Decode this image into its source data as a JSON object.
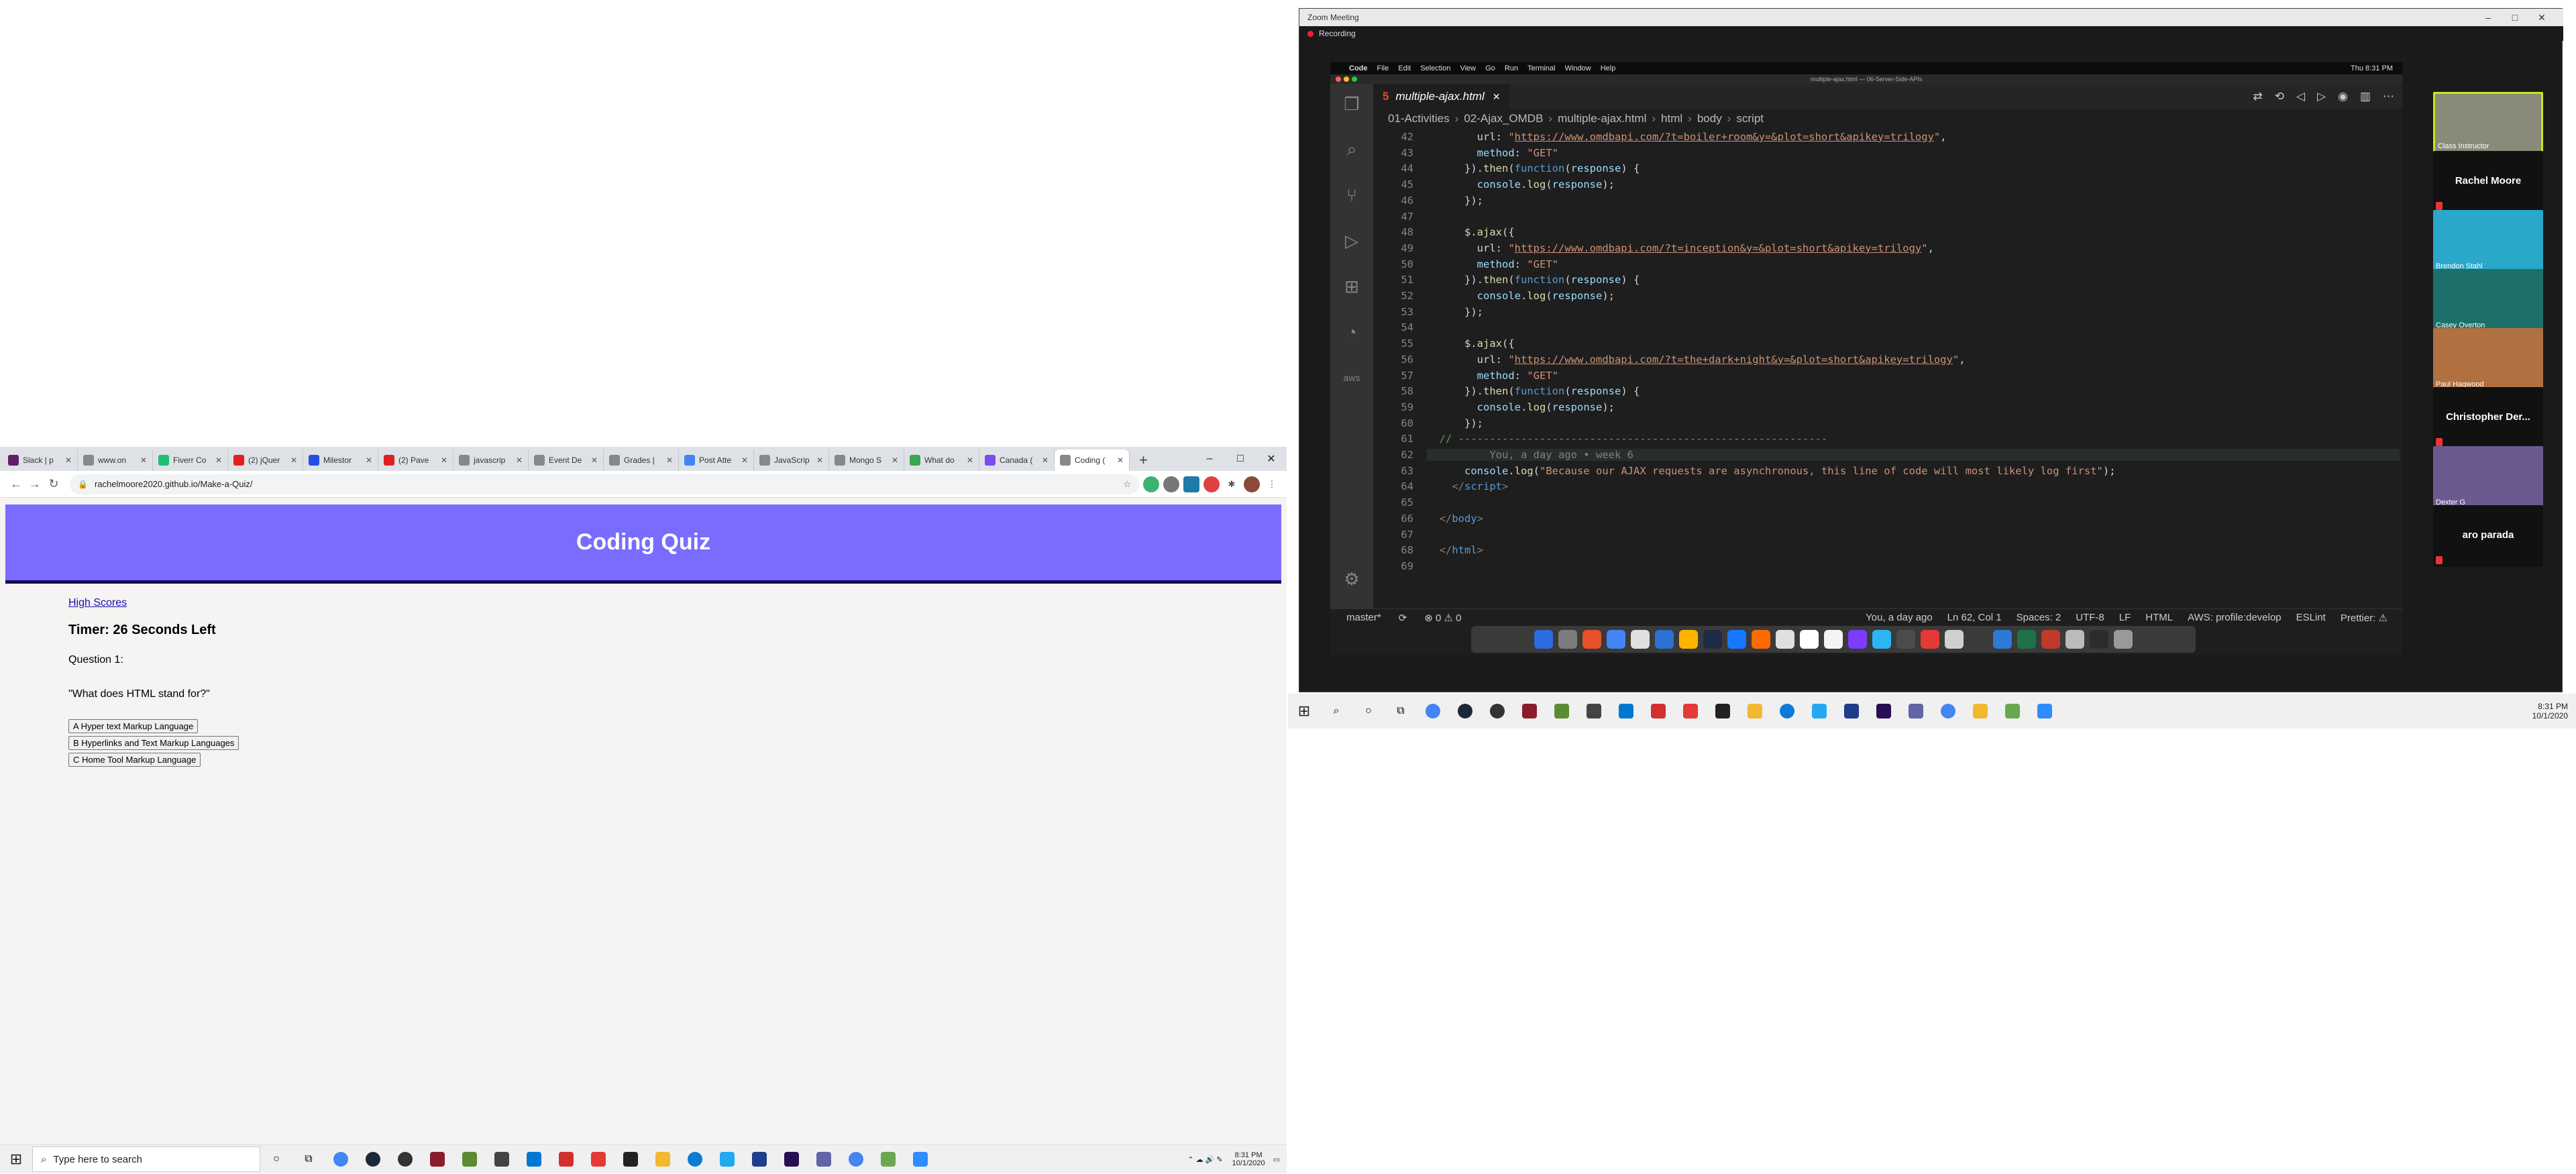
{
  "chrome": {
    "tabs": [
      {
        "label": "Slack | p",
        "color": "#611f69"
      },
      {
        "label": "www.on",
        "color": "#888888"
      },
      {
        "label": "Fiverr Co",
        "color": "#1dbf73"
      },
      {
        "label": "(2) jQuer",
        "color": "#e02020"
      },
      {
        "label": "Milestor",
        "color": "#264de4"
      },
      {
        "label": "(2) Pave",
        "color": "#e02020"
      },
      {
        "label": "javascrip",
        "color": "#888888"
      },
      {
        "label": "Event De",
        "color": "#888888"
      },
      {
        "label": "Grades |",
        "color": "#888888"
      },
      {
        "label": "Post Atte",
        "color": "#4285f4"
      },
      {
        "label": "JavaScrip",
        "color": "#888888"
      },
      {
        "label": "Mongo S",
        "color": "#888888"
      },
      {
        "label": "What do",
        "color": "#34a853"
      },
      {
        "label": "Canada (",
        "color": "#7a4cf0"
      },
      {
        "label": "Coding (",
        "color": "#888888"
      }
    ],
    "active_tab": 14,
    "url": "rachelmoore2020.github.io/Make-a-Quiz/",
    "win": {
      "min": "–",
      "max": "□",
      "close": "✕"
    },
    "newtab": "+"
  },
  "quiz": {
    "title": "Coding Quiz",
    "highscores": "High Scores",
    "timer": "Timer: 26 Seconds Left",
    "question_number": "Question 1:",
    "question_text": "\"What does HTML stand for?\"",
    "answers": [
      "A Hyper text Markup Language",
      "B Hyperlinks and Text Markup Languages",
      "C Home Tool Markup Language"
    ]
  },
  "left_taskbar": {
    "search_placeholder": "Type here to search",
    "time": "8:31 PM",
    "date": "10/1/2020"
  },
  "zoom": {
    "title": "Zoom Meeting",
    "recording": "Recording",
    "mac_menu": [
      "Code",
      "File",
      "Edit",
      "Selection",
      "View",
      "Go",
      "Run",
      "Terminal",
      "Window",
      "Help"
    ],
    "mac_clock": "Thu 8:31 PM",
    "vscode_title": "multiple-ajax.html — 06-Server-Side-APIs",
    "file_tab": "multiple-ajax.html",
    "breadcrumb": [
      "01-Activities",
      "02-Ajax_OMDB",
      "multiple-ajax.html",
      "html",
      "body",
      "script"
    ],
    "code_lines": [
      {
        "n": "42",
        "html": "        url: <span class='s'>\"</span><span class='u'>https://www.omdbapi.com/?t=boiler+room&y=&plot=short&apikey=trilogy</span><span class='s'>\"</span>,"
      },
      {
        "n": "43",
        "html": "        <span class='p'>method</span>: <span class='s'>\"GET\"</span>"
      },
      {
        "n": "44",
        "html": "      }).<span class='f'>then</span>(<span class='v'>function</span>(<span class='p'>response</span>) {"
      },
      {
        "n": "45",
        "html": "        <span class='p'>console</span>.<span class='f'>log</span>(<span class='p'>response</span>);"
      },
      {
        "n": "46",
        "html": "      });"
      },
      {
        "n": "47",
        "html": ""
      },
      {
        "n": "48",
        "html": "      $.<span class='f'>ajax</span>({"
      },
      {
        "n": "49",
        "html": "        url: <span class='s'>\"</span><span class='u'>https://www.omdbapi.com/?t=inception&y=&plot=short&apikey=trilogy</span><span class='s'>\"</span>,"
      },
      {
        "n": "50",
        "html": "        <span class='p'>method</span>: <span class='s'>\"GET\"</span>"
      },
      {
        "n": "51",
        "html": "      }).<span class='f'>then</span>(<span class='v'>function</span>(<span class='p'>response</span>) {"
      },
      {
        "n": "52",
        "html": "        <span class='p'>console</span>.<span class='f'>log</span>(<span class='p'>response</span>);"
      },
      {
        "n": "53",
        "html": "      });"
      },
      {
        "n": "54",
        "html": ""
      },
      {
        "n": "55",
        "html": "      $.<span class='f'>ajax</span>({"
      },
      {
        "n": "56",
        "html": "        url: <span class='s'>\"</span><span class='u'>https://www.omdbapi.com/?t=the+dark+night&y=&plot=short&apikey=trilogy</span><span class='s'>\"</span>,"
      },
      {
        "n": "57",
        "html": "        <span class='p'>method</span>: <span class='s'>\"GET\"</span>"
      },
      {
        "n": "58",
        "html": "      }).<span class='f'>then</span>(<span class='v'>function</span>(<span class='p'>response</span>) {"
      },
      {
        "n": "59",
        "html": "        <span class='p'>console</span>.<span class='f'>log</span>(<span class='p'>response</span>);"
      },
      {
        "n": "60",
        "html": "      });"
      },
      {
        "n": "61",
        "html": "  <span class='c'>// -----------------------------------------------------------</span>"
      },
      {
        "n": "62",
        "html": "  <span class='t'>        You, a day ago • week 6</span>"
      },
      {
        "n": "63",
        "html": "      <span class='p'>console</span>.<span class='f'>log</span>(<span class='s'>\"Because our AJAX requests are asynchronous, this line of code will most likely log first\"</span>);"
      },
      {
        "n": "64",
        "html": "    <span class='t'>&lt;/</span><span class='v'>script</span><span class='t'>&gt;</span>"
      },
      {
        "n": "65",
        "html": ""
      },
      {
        "n": "66",
        "html": "  <span class='t'>&lt;/</span><span class='v'>body</span><span class='t'>&gt;</span>"
      },
      {
        "n": "67",
        "html": ""
      },
      {
        "n": "68",
        "html": "  <span class='t'>&lt;/</span><span class='v'>html</span><span class='t'>&gt;</span>"
      },
      {
        "n": "69",
        "html": ""
      }
    ],
    "status_left": [
      "master*",
      "⟳",
      "⊗ 0 ⚠ 0"
    ],
    "status_right": [
      "You, a day ago",
      "Ln 62, Col 1",
      "Spaces: 2",
      "UTF-8",
      "LF",
      "HTML",
      "AWS: profile:develop",
      "ESLint",
      "Prettier: ⚠"
    ],
    "participants": [
      {
        "name": "Class Instructor",
        "video": true,
        "color": "#8a8a7a"
      },
      {
        "name": "Rachel Moore",
        "video": false
      },
      {
        "name": "Brendon Stahl",
        "video": true,
        "color": "#2aa8c9"
      },
      {
        "name": "Casey Overton",
        "video": true,
        "color": "#1d6f6a"
      },
      {
        "name": "Paul Hagwood",
        "video": true,
        "color": "#b07040"
      },
      {
        "name": "Christopher  Der...",
        "video": false
      },
      {
        "name": "Dexter G",
        "video": true,
        "color": "#6a5a90"
      },
      {
        "name": "aro parada",
        "video": false
      }
    ]
  },
  "right_taskbar": {
    "time": "8:31 PM",
    "date": "10/1/2020"
  }
}
